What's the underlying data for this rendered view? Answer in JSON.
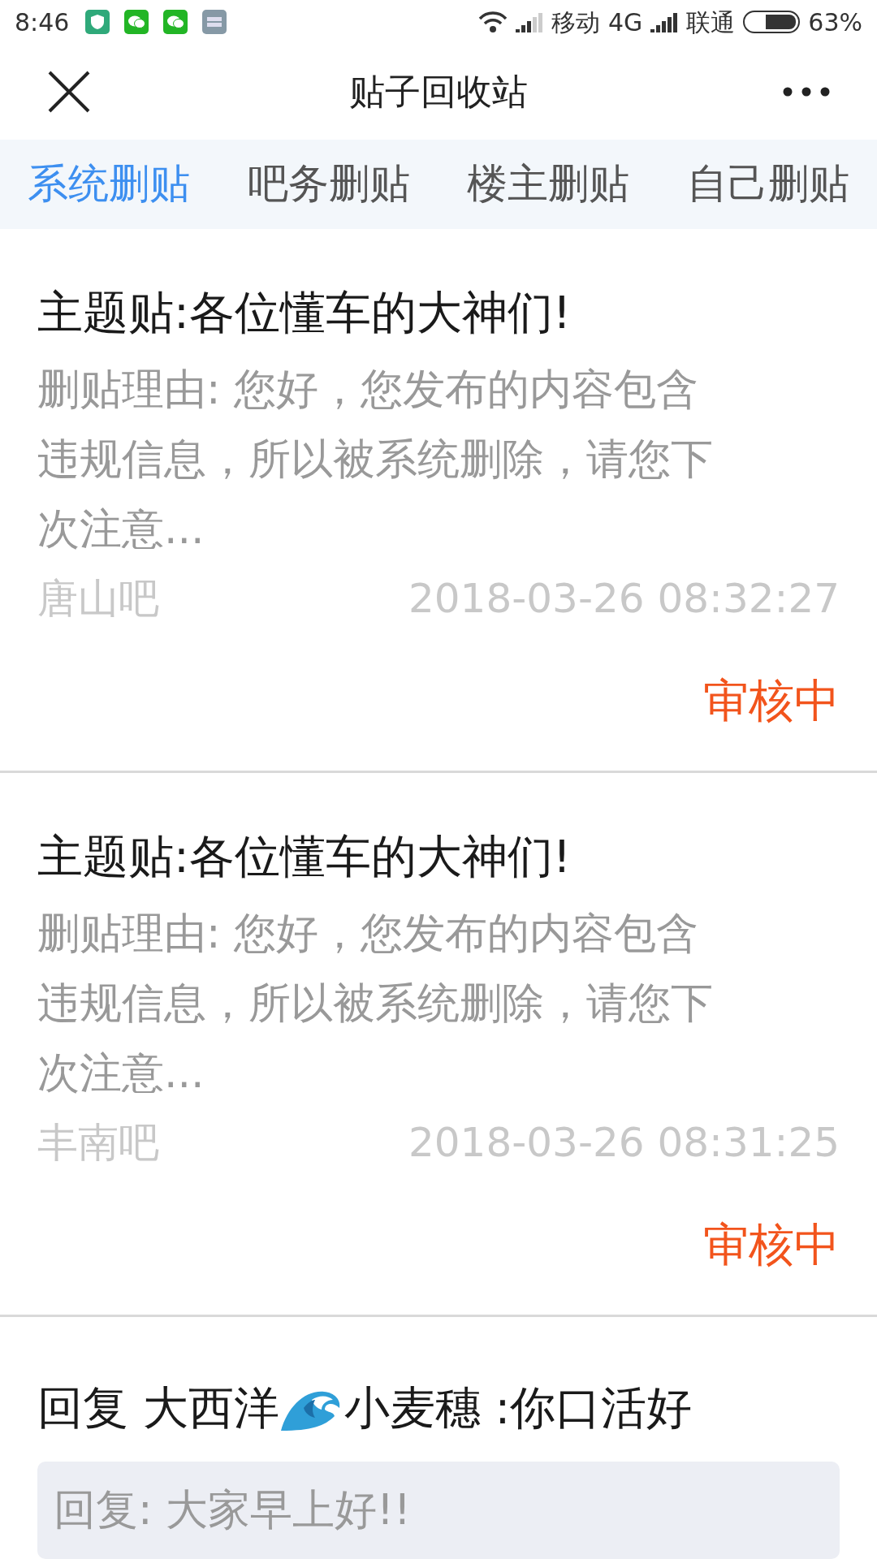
{
  "status_bar": {
    "time": "8:46",
    "carrier_1": "移动",
    "network": "4G",
    "carrier_2": "联通",
    "battery": {
      "text": "63%",
      "level": 0.63
    }
  },
  "nav": {
    "title": "贴子回收站"
  },
  "tabs": [
    {
      "label": "系统删贴",
      "selected": true
    },
    {
      "label": "吧务删贴",
      "selected": false
    },
    {
      "label": "楼主删贴",
      "selected": false
    },
    {
      "label": "自己删贴",
      "selected": false
    }
  ],
  "posts": [
    {
      "title": "主题贴:各位懂车的大神们!",
      "reason_lines": [
        "删贴理由: 您好，您发布的内容包含",
        "违规信息，所以被系统删除，请您下",
        "次注意..."
      ],
      "forum": "唐山吧",
      "time": "2018-03-26 08:32:27",
      "status": "审核中"
    },
    {
      "title": "主题贴:各位懂车的大神们!",
      "reason_lines": [
        "删贴理由: 您好，您发布的内容包含",
        "违规信息，所以被系统删除，请您下",
        "次注意..."
      ],
      "forum": "丰南吧",
      "time": "2018-03-26 08:31:25",
      "status": "审核中"
    }
  ],
  "reply": {
    "title_before": "回复 大西洋",
    "title_after": "小麦穗 :你口活好",
    "quote": "回复: 大家早上好!!"
  }
}
